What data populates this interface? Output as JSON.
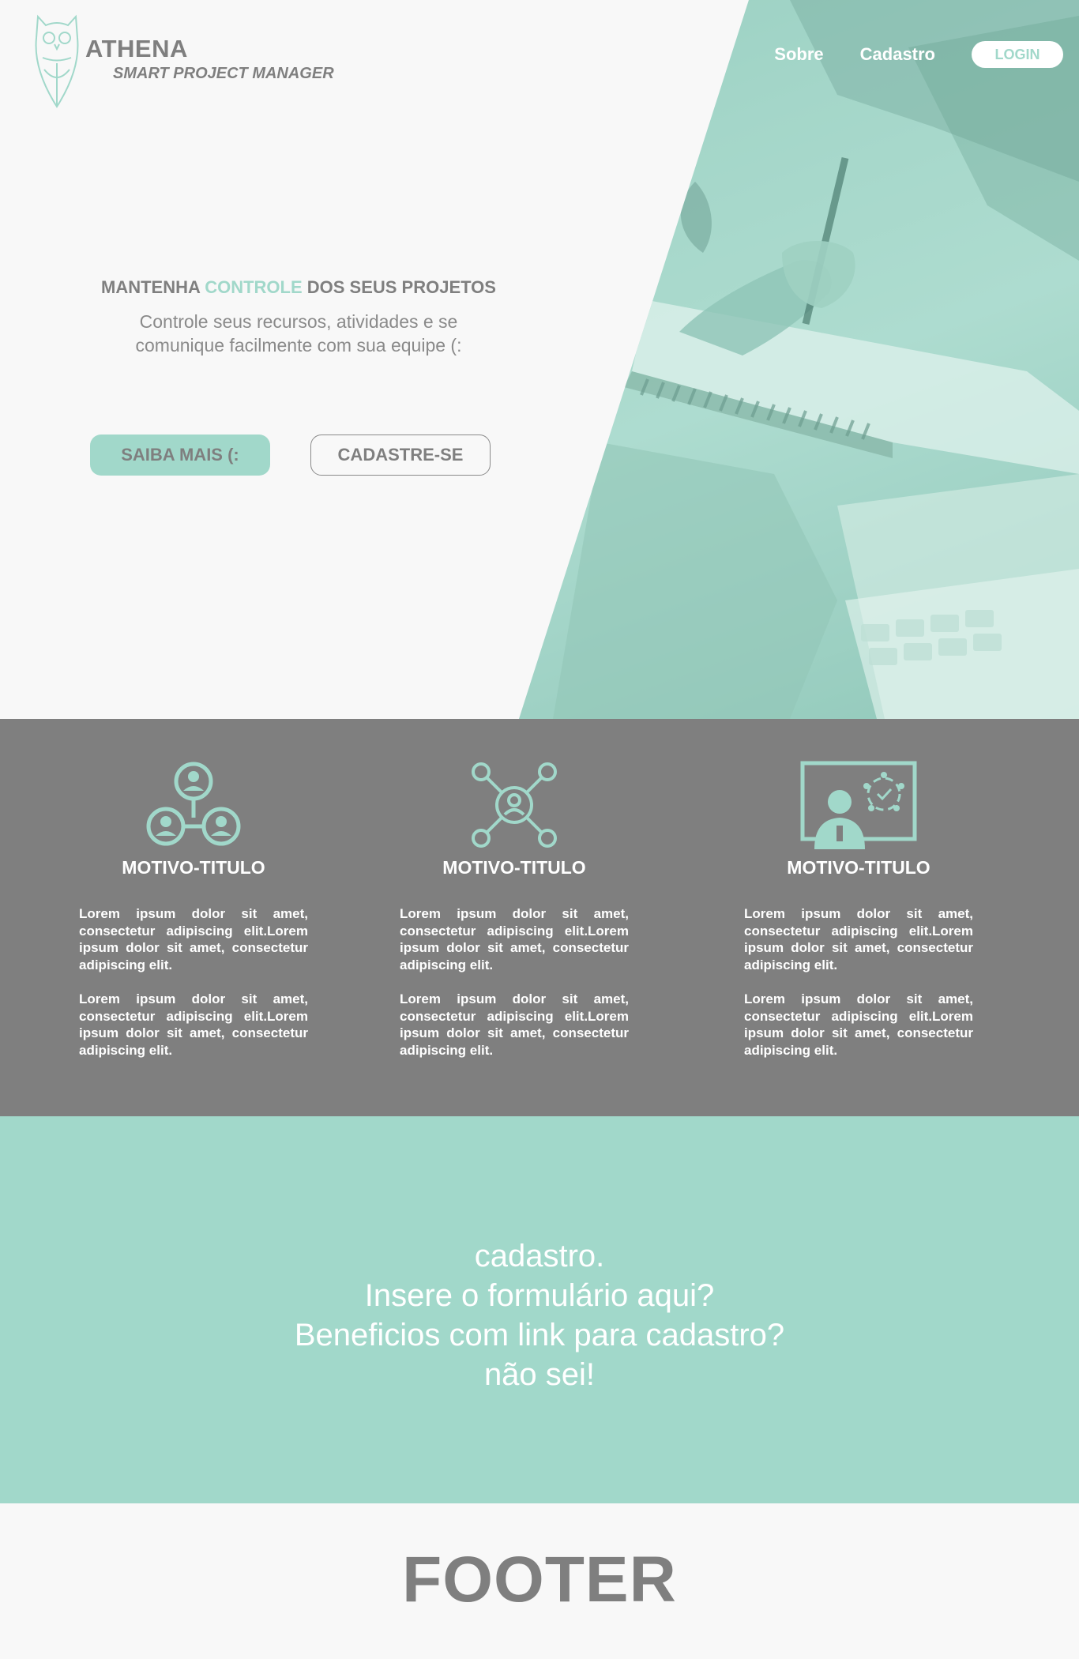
{
  "brand": {
    "name": "ATHENA",
    "tagline": "SMART PROJECT MANAGER",
    "logo_icon": "owl-icon",
    "accent_color": "#a1d8ca",
    "text_color": "#7f7f7f"
  },
  "nav": {
    "items": [
      "Sobre",
      "Cadastro"
    ],
    "login_label": "LOGIN"
  },
  "hero": {
    "title_prefix": "MANTENHA ",
    "title_accent": "CONTROLE",
    "title_suffix": " DOS SEUS PROJETOS",
    "subtitle_line1": "Controle seus recursos, atividades e se",
    "subtitle_line2": "comunique facilmente com sua equipe (:",
    "primary_button": "SAIBA MAIS (:",
    "secondary_button": "CADASTRE-SE"
  },
  "features": [
    {
      "icon": "team-network-icon",
      "title": "MOTIVO-TITULO",
      "paragraphs": [
        " Lorem ipsum dolor sit amet, consectetur adipiscing elit.Lorem ipsum dolor sit amet, consectetur adipiscing elit.",
        " Lorem ipsum dolor sit amet, consectetur adipiscing elit.Lorem ipsum dolor sit amet, consectetur adipiscing elit."
      ]
    },
    {
      "icon": "user-connections-icon",
      "title": "MOTIVO-TITULO",
      "paragraphs": [
        " Lorem ipsum dolor sit amet, consectetur adipiscing elit.Lorem ipsum dolor sit amet, consectetur adipiscing elit.",
        " Lorem ipsum dolor sit amet, consectetur adipiscing elit.Lorem ipsum dolor sit amet, consectetur adipiscing elit."
      ]
    },
    {
      "icon": "presentation-board-icon",
      "title": "MOTIVO-TITULO",
      "paragraphs": [
        " Lorem ipsum dolor sit amet, consectetur adipiscing elit.Lorem ipsum dolor sit amet, consectetur adipiscing elit.",
        " Lorem ipsum dolor sit amet, consectetur adipiscing elit.Lorem ipsum dolor sit amet, consectetur adipiscing elit."
      ]
    }
  ],
  "cta": {
    "lines": [
      "cadastro.",
      "Insere o formulário aqui?",
      "Beneficios com link para cadastro?",
      "não sei!"
    ]
  },
  "footer": {
    "label": "FOOTER"
  }
}
